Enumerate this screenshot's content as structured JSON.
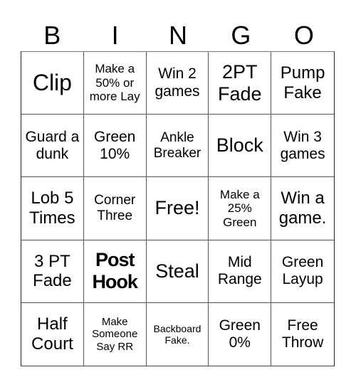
{
  "header": {
    "letters": [
      "B",
      "I",
      "N",
      "G",
      "O"
    ]
  },
  "cells": [
    "Clip",
    "Make a 50% or more Lay",
    "Win 2 games",
    "2PT Fade",
    "Pump Fake",
    "Guard a dunk",
    "Green 10%",
    "Ankle Breaker",
    "Block",
    "Win 3 games",
    "Lob 5 Times",
    "Corner Three",
    "Free!",
    "Make a 25% Green",
    "Win a game.",
    "3 PT Fade",
    "Post Hook",
    "Steal",
    "Mid Range",
    "Green Layup",
    "Half Court",
    "Make Someone Say RR",
    "Backboard Fake.",
    "Green 0%",
    "Free Throw"
  ]
}
